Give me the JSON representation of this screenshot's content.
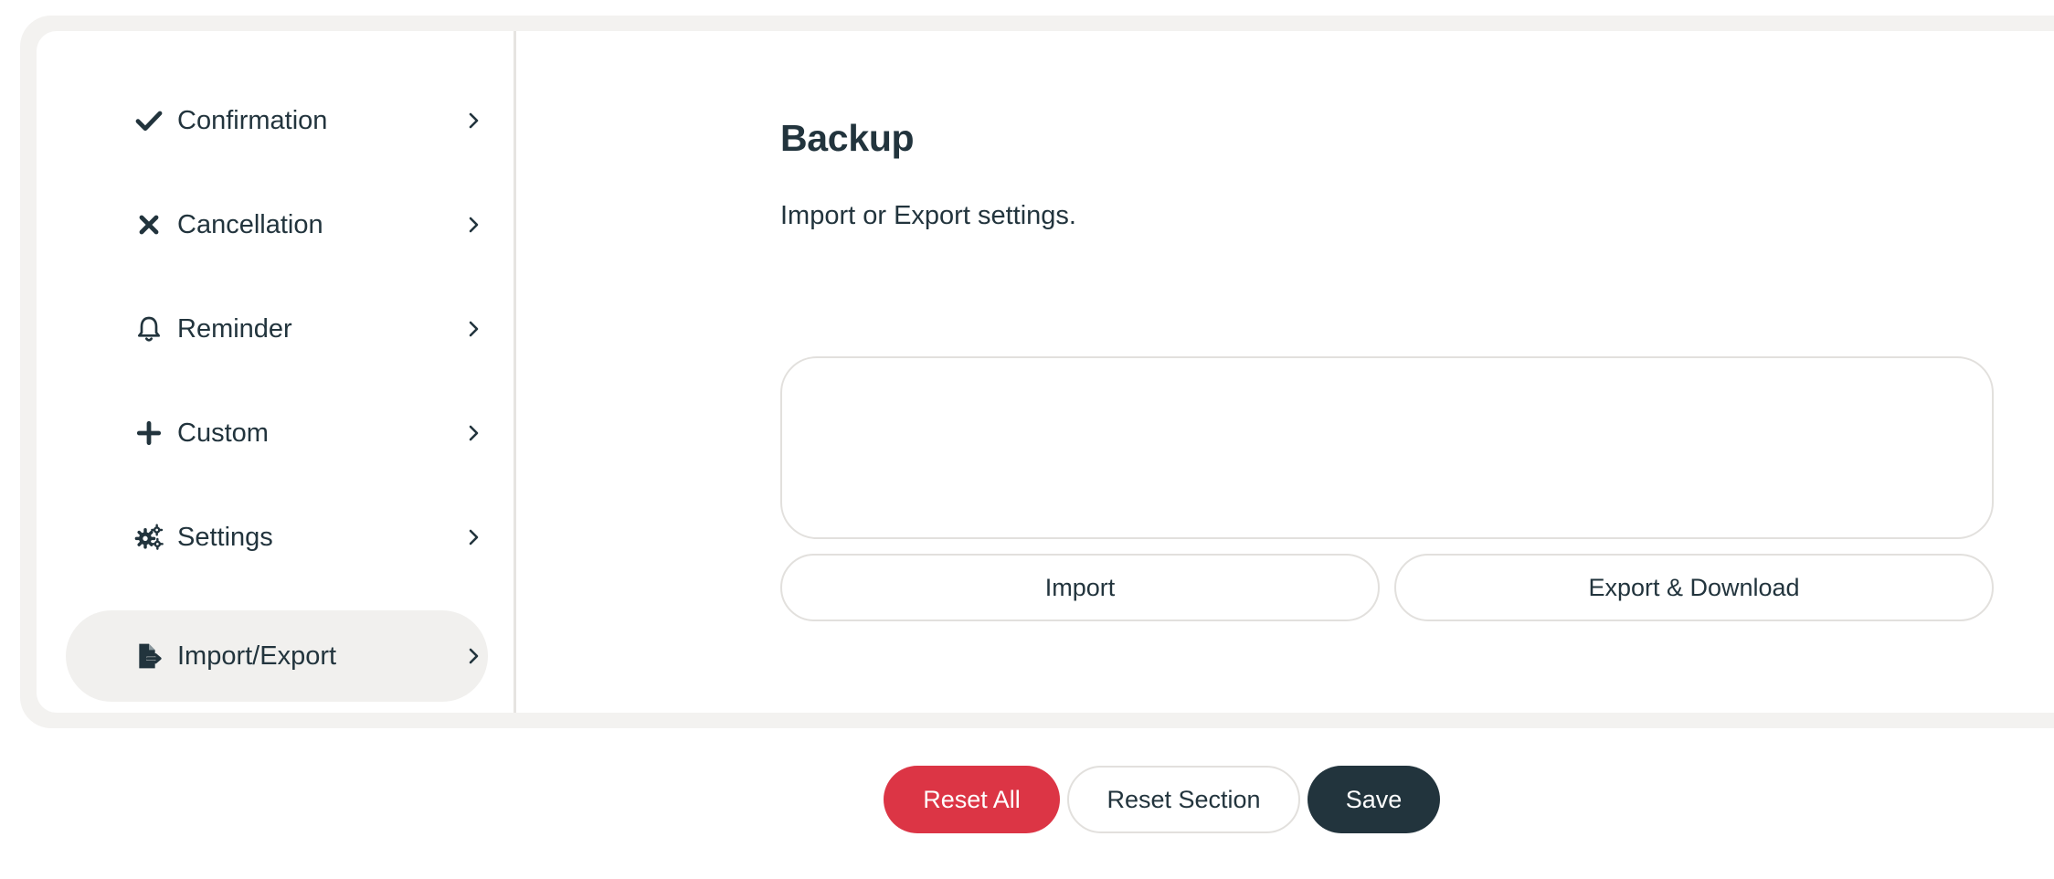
{
  "sidebar": {
    "items": [
      {
        "label": "Confirmation",
        "icon": "check-icon",
        "active": false
      },
      {
        "label": "Cancellation",
        "icon": "x-icon",
        "active": false
      },
      {
        "label": "Reminder",
        "icon": "bell-icon",
        "active": false
      },
      {
        "label": "Custom",
        "icon": "plus-icon",
        "active": false
      },
      {
        "label": "Settings",
        "icon": "gears-icon",
        "active": false
      },
      {
        "label": "Import/Export",
        "icon": "file-export-icon",
        "active": true
      }
    ]
  },
  "main": {
    "title": "Backup",
    "description": "Import or Export settings.",
    "backup_textarea": {
      "value": "",
      "placeholder": ""
    },
    "import_label": "Import",
    "export_label": "Export & Download"
  },
  "footer": {
    "reset_all_label": "Reset All",
    "reset_section_label": "Reset Section",
    "save_label": "Save"
  },
  "colors": {
    "primary_dark": "#22343d",
    "danger": "#dc3545",
    "frame_bg": "#f3f2f0",
    "active_item_bg": "#f1f0ee"
  }
}
